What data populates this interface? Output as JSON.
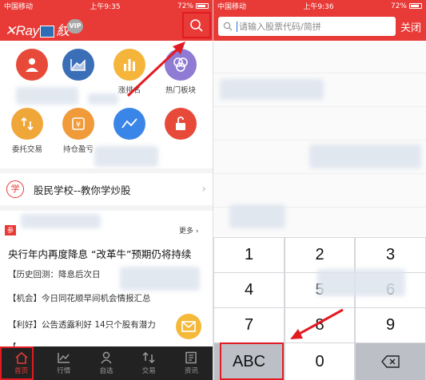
{
  "left_screen": {
    "status": {
      "carrier": "中国移动",
      "time": "上午9:35",
      "battery": "72%"
    },
    "header": {
      "logo_text": "Ray",
      "logo_suffix": "紋",
      "vip": "VIP"
    },
    "shortcuts": [
      {
        "label": "",
        "icon": "user-icon",
        "color": "#e84a3a"
      },
      {
        "label": "",
        "icon": "chart-icon",
        "color": "#3a6fb8"
      },
      {
        "label": "涨排名",
        "icon": "bar-chart-icon",
        "color": "#f5b53a"
      },
      {
        "label": "热门板块",
        "icon": "hot-sector-icon",
        "color": "#8f7ad4"
      },
      {
        "label": "委托交易",
        "icon": "trade-icon",
        "color": "#f0a73a"
      },
      {
        "label": "持仓盈亏",
        "icon": "wallet-icon",
        "color": "#f09a3a"
      },
      {
        "label": "",
        "icon": "line-chart-icon",
        "color": "#3a86e8"
      },
      {
        "label": "",
        "icon": "unlock-icon",
        "color": "#e84a3a"
      }
    ],
    "school": {
      "badge": "学",
      "text": "股民学校--教你学炒股"
    },
    "news": {
      "tag": "参",
      "more": "更多",
      "headline": "央行年内再度降息 “改革牛”预期仍将持续",
      "items": [
        "【历史回测：降息后次日",
        "【机会】今日同花顺早间机会情报汇总",
        "【利好】公告透露利好 14只个股有潜力",
        "【"
      ]
    },
    "tabs": [
      {
        "label": "首页",
        "icon": "home-icon",
        "active": true
      },
      {
        "label": "行情",
        "icon": "market-icon",
        "active": false
      },
      {
        "label": "自选",
        "icon": "watchlist-icon",
        "active": false
      },
      {
        "label": "交易",
        "icon": "transfer-icon",
        "active": false
      },
      {
        "label": "资讯",
        "icon": "news-icon",
        "active": false
      }
    ]
  },
  "right_screen": {
    "status": {
      "carrier": "中国移动",
      "time": "上午9:36",
      "battery": "72%"
    },
    "search": {
      "placeholder": "请输入股票代码/简拼",
      "close_label": "关闭"
    },
    "keypad": {
      "keys": [
        "1",
        "2",
        "3",
        "4",
        "5",
        "6",
        "7",
        "8",
        "9"
      ],
      "abc": "ABC",
      "zero": "0",
      "delete_icon": "backspace-icon"
    }
  },
  "colors": {
    "brand_red": "#e83a36",
    "highlight": "#e21b23"
  }
}
